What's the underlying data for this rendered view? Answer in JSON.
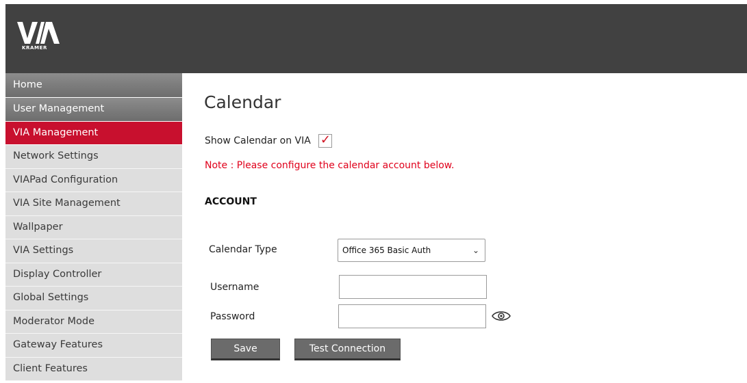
{
  "header": {
    "logo_text": "VIA",
    "brand_text": "KRAMER"
  },
  "sidebar": {
    "items": [
      {
        "label": "Home",
        "state": "grey"
      },
      {
        "label": "User Management",
        "state": "grey"
      },
      {
        "label": "VIA Management",
        "state": "active"
      },
      {
        "label": "Network Settings",
        "state": "light"
      },
      {
        "label": "VIAPad Configuration",
        "state": "light"
      },
      {
        "label": "VIA Site Management",
        "state": "light"
      },
      {
        "label": "Wallpaper",
        "state": "light"
      },
      {
        "label": "VIA Settings",
        "state": "light"
      },
      {
        "label": "Display Controller",
        "state": "light"
      },
      {
        "label": "Global Settings",
        "state": "light"
      },
      {
        "label": "Moderator Mode",
        "state": "light"
      },
      {
        "label": "Gateway Features",
        "state": "light"
      },
      {
        "label": "Client Features",
        "state": "light"
      }
    ]
  },
  "main": {
    "title": "Calendar",
    "show_calendar_label": "Show Calendar on VIA",
    "show_calendar_checked": true,
    "note": "Note : Please configure the calendar account below.",
    "section_title": "ACCOUNT",
    "calendar_type_label": "Calendar Type",
    "calendar_type_value": "Office 365 Basic Auth",
    "username_label": "Username",
    "username_value": "",
    "password_label": "Password",
    "password_value": "",
    "save_label": "Save",
    "test_connection_label": "Test Connection"
  },
  "colors": {
    "header_bg": "#414141",
    "active_nav": "#c8102e",
    "note_red": "#e0001b",
    "button_bg": "#6b6b6b"
  }
}
